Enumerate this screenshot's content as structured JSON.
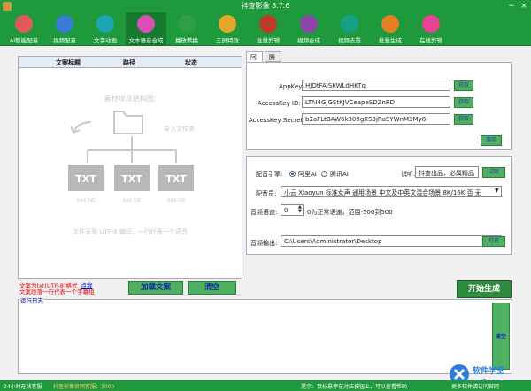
{
  "window": {
    "title": "抖查影像 8.7.6",
    "min_glyph": "−",
    "close_glyph": "×"
  },
  "toolbar": {
    "items": [
      {
        "label": "AI智能配音",
        "icon": "ai-voice-icon",
        "color": "#e15b5b"
      },
      {
        "label": "视频配音",
        "icon": "video-dub-icon",
        "color": "#3a7bd5"
      },
      {
        "label": "文字动画",
        "icon": "text-anim-icon",
        "color": "#1aa6b7"
      },
      {
        "label": "文本语音合成",
        "icon": "tts-icon",
        "color": "#d94fb3",
        "active": true
      },
      {
        "label": "播放转换",
        "icon": "play-convert-icon",
        "color": "#2f9e44"
      },
      {
        "label": "三屏特效",
        "icon": "triple-screen-icon",
        "color": "#e0a72b"
      },
      {
        "label": "批量剪辑",
        "icon": "batch-edit-icon",
        "color": "#c0392b"
      },
      {
        "label": "视频合成",
        "icon": "video-merge-icon",
        "color": "#8e44ad"
      },
      {
        "label": "视频去重",
        "icon": "dedupe-icon",
        "color": "#16a085"
      },
      {
        "label": "批量生成",
        "icon": "batch-generate-icon",
        "color": "#e67e22"
      },
      {
        "label": "在线剪辑",
        "icon": "online-edit-icon",
        "color": "#e84393"
      }
    ]
  },
  "file_table": {
    "headers": [
      "文案标题",
      "路径",
      "状态"
    ],
    "placeholder_title": "素材项目结构图:",
    "placeholder_note": "导入文件夹",
    "file_icon_text": "TXT",
    "file_names": [
      "xxx.txt",
      "xxx.txt",
      "xxx.txt"
    ],
    "footer_hint": "文件采用 UTF-8 编码，一行代表一个语音"
  },
  "tips": {
    "line1": "文案为txt(UTF-8)格式",
    "link": "点我",
    "line2": "文案段落一行代表一个字幕组"
  },
  "buttons": {
    "load_copy": "加载文案",
    "clear": "清空",
    "start": "开始生成",
    "save_config": "保存",
    "audition": "试听",
    "open": "打开",
    "log_clear": "清空"
  },
  "tabs": [
    "阿里",
    "腾讯"
  ],
  "api": {
    "appkey_label": "AppKey:",
    "appkey_value": "HJOtFAISKWLdHKTq",
    "access_id_label": "AccessKey ID:",
    "access_id_value": "LTAI4GJGStKJVCeapeSDZnRD",
    "access_secret_label": "AccessKey Secret:",
    "access_secret_value": "b2aFLtBAW6k309gXS3jRaSYWnM3My8",
    "btn_get": "获取"
  },
  "synthesis": {
    "engine_label": "配音引擎:",
    "engine_options": [
      "阿里AI",
      "腾讯AI"
    ],
    "engine_selected": 0,
    "audition_label": "试听:",
    "audition_text": "抖查出品，必属精品",
    "voice_label": "配音员:",
    "voice_value": "小云 Xiaoyun 标准女声 通用场景 中文及中英文混合场景 8K/16K 否 无",
    "speed_label": "音频语速:",
    "speed_value": "0",
    "speed_hint": "0为正常语速，范围-500到500",
    "output_label": "音频输出:",
    "output_value": "C:\\Users\\Administrator\\Desktop"
  },
  "log": {
    "label": "运行日志"
  },
  "statusbar": {
    "left": "24小时在线客服",
    "mid": "抖查影像官网客服：3000",
    "right1": "提示：鼠标悬停在对应按钮上，可以查看帮助",
    "right2": "更多软件请访问官网"
  },
  "watermarks": {
    "site": "xz7.com",
    "brand": "软件学堂"
  }
}
